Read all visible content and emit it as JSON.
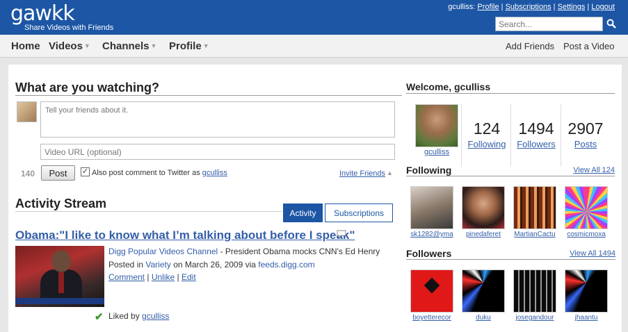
{
  "header": {
    "logo": "gawkk",
    "tagline": "Share Videos with Friends",
    "username_prefix": "gculliss:",
    "links": [
      "Profile",
      "Subscriptions",
      "Settings",
      "Logout"
    ],
    "search_placeholder": "Search..."
  },
  "nav": {
    "items": [
      "Home",
      "Videos",
      "Channels",
      "Profile"
    ],
    "right": [
      "Add Friends",
      "Post a Video"
    ]
  },
  "composer": {
    "title": "What are you watching?",
    "text_placeholder": "Tell your friends about it.",
    "url_placeholder": "Video URL (optional)",
    "char_count": "140",
    "post_label": "Post",
    "twitter_label": "Also post comment to Twitter as",
    "twitter_user": "gculliss",
    "twitter_checked": true,
    "invite_label": "Invite Friends"
  },
  "activity": {
    "title": "Activity Stream",
    "tabs": [
      "Activity",
      "Subscriptions"
    ],
    "active_tab": "Activity",
    "story": {
      "title": "Obama:\"I like to know what I’m talking about before I speak\"",
      "channel": "Digg Popular Videos Channel",
      "description": " - President Obama mocks CNN's Ed Henry",
      "posted_prefix": "Posted in",
      "category": "Variety",
      "date_text": "on March 26, 2009 via",
      "source": "feeds.digg.com",
      "actions": [
        "Comment",
        "Unlike",
        "Edit"
      ],
      "liked_prefix": "Liked by",
      "liked_user": "gculliss"
    }
  },
  "profile": {
    "welcome": "Welcome, gculliss",
    "username": "gculliss",
    "stats": [
      {
        "value": "124",
        "label": "Following"
      },
      {
        "value": "1494",
        "label": "Followers"
      },
      {
        "value": "2907",
        "label": "Posts"
      }
    ]
  },
  "following": {
    "title": "Following",
    "view_all": "View All 124",
    "users": [
      "sk1282@yma",
      "pinedaferet",
      "MartianCactu",
      "cosmicmoxa"
    ]
  },
  "followers": {
    "title": "Followers",
    "view_all": "View All 1494",
    "users": [
      "boyetterecor",
      "duku",
      "josegandour",
      "jhaantu"
    ]
  },
  "colors": {
    "brand_blue": "#1c56a5",
    "link": "#335ea8",
    "like_green": "#3a9a2a"
  }
}
